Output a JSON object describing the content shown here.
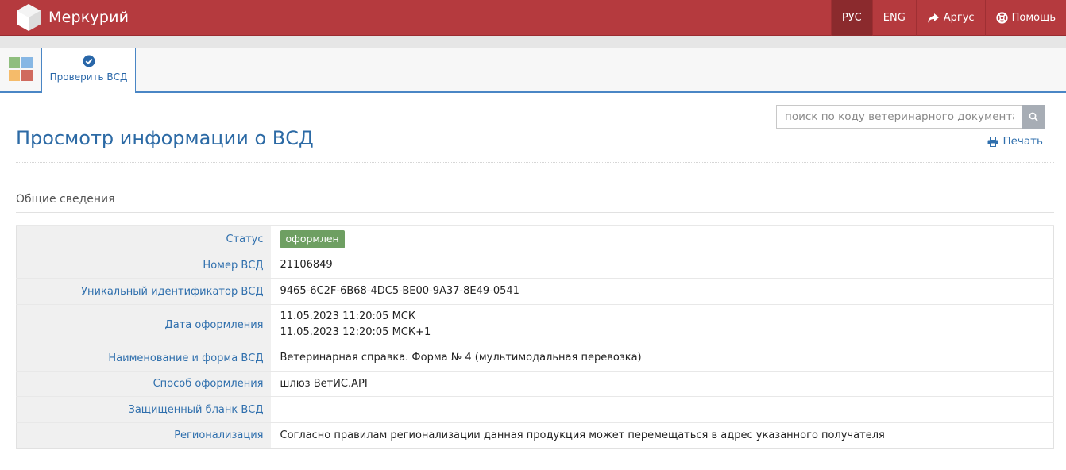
{
  "app": {
    "name": "Меркурий"
  },
  "nav": [
    {
      "label": "РУС",
      "active": true,
      "icon": ""
    },
    {
      "label": "ENG",
      "active": false,
      "icon": ""
    },
    {
      "label": "Аргус",
      "active": false,
      "icon": "share-arrow-icon"
    },
    {
      "label": "Помощь",
      "active": false,
      "icon": "lifebuoy-icon"
    }
  ],
  "tabs": [
    {
      "label": "Проверить ВСД",
      "icon": "check-circle-icon"
    }
  ],
  "search": {
    "placeholder": "поиск по коду ветеринарного документа"
  },
  "print_label": "Печать",
  "page_title": "Просмотр информации о ВСД",
  "section_title": "Общие сведения",
  "rows": [
    {
      "label": "Статус",
      "badge": "оформлен"
    },
    {
      "label": "Номер ВСД",
      "value": "21106849"
    },
    {
      "label": "Уникальный идентификатор ВСД",
      "value": "9465-6C2F-6B68-4DC5-BE00-9A37-8E49-0541"
    },
    {
      "label": "Дата оформления",
      "lines": [
        "11.05.2023 11:20:05 МСК",
        "11.05.2023 12:20:05 МСК+1"
      ]
    },
    {
      "label": "Наименование и форма ВСД",
      "value": "Ветеринарная справка. Форма № 4 (мультимодальная перевозка)"
    },
    {
      "label": "Способ оформления",
      "value": "шлюз ВетИС.API"
    },
    {
      "label": "Защищенный бланк ВСД",
      "value": ""
    },
    {
      "label": "Регионализация",
      "value": "Согласно правилам регионализации данная продукция может перемещаться в адрес указанного получателя"
    }
  ],
  "colors": {
    "navbar": "#b53a3e",
    "accent": "#2f6fad",
    "status_badge": "#6e9f62"
  }
}
